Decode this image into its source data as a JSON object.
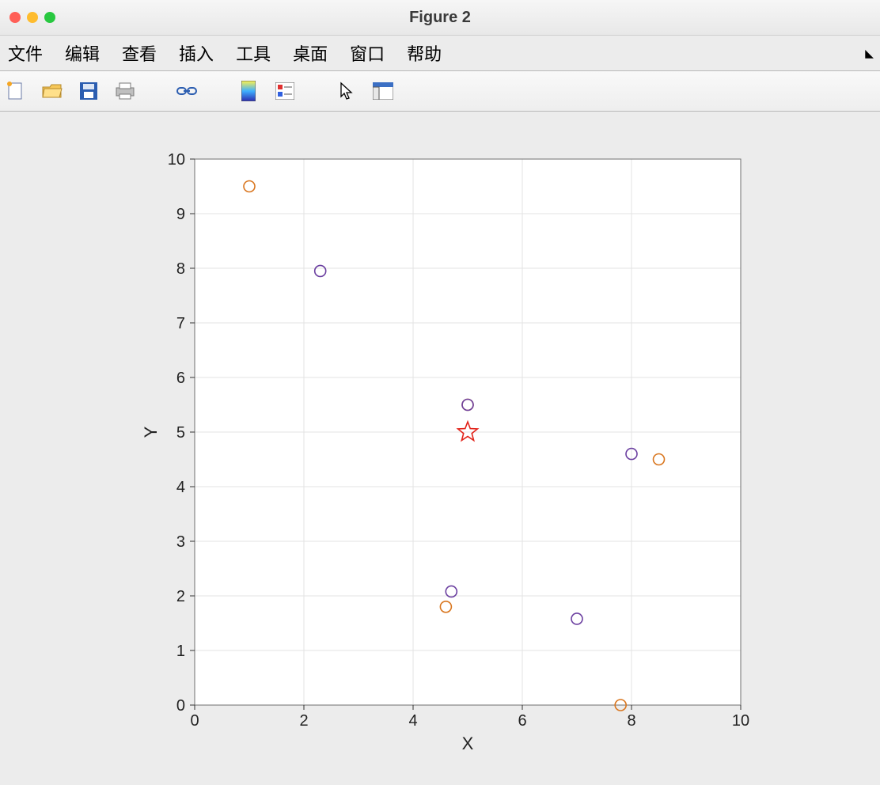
{
  "window": {
    "title": "Figure 2"
  },
  "menu": {
    "items": [
      "文件",
      "编辑",
      "查看",
      "插入",
      "工具",
      "桌面",
      "窗口",
      "帮助"
    ]
  },
  "toolbar": {
    "buttons": [
      "new-figure",
      "open",
      "save",
      "print",
      "link",
      "colorbar",
      "legend",
      "cursor",
      "panel"
    ]
  },
  "chart_data": {
    "type": "scatter",
    "title": "",
    "xlabel": "X",
    "ylabel": "Y",
    "xlim": [
      0,
      10
    ],
    "ylim": [
      0,
      10
    ],
    "xticks": [
      0,
      2,
      4,
      6,
      8,
      10
    ],
    "yticks": [
      0,
      1,
      2,
      3,
      4,
      5,
      6,
      7,
      8,
      9,
      10
    ],
    "grid": true,
    "series": [
      {
        "name": "orange-circles",
        "marker": "o",
        "color": "#d9761f",
        "points": [
          {
            "x": 1.0,
            "y": 9.5
          },
          {
            "x": 5.0,
            "y": 5.5
          },
          {
            "x": 4.6,
            "y": 1.8
          },
          {
            "x": 7.8,
            "y": 0.0
          },
          {
            "x": 8.5,
            "y": 4.5
          }
        ]
      },
      {
        "name": "purple-circles",
        "marker": "o",
        "color": "#6b3fa0",
        "points": [
          {
            "x": 2.3,
            "y": 7.95
          },
          {
            "x": 5.0,
            "y": 5.5
          },
          {
            "x": 4.7,
            "y": 2.08
          },
          {
            "x": 7.0,
            "y": 1.58
          },
          {
            "x": 8.0,
            "y": 4.6
          }
        ]
      },
      {
        "name": "red-star",
        "marker": "star",
        "color": "#e2231a",
        "points": [
          {
            "x": 5.0,
            "y": 5.0
          }
        ]
      }
    ]
  }
}
